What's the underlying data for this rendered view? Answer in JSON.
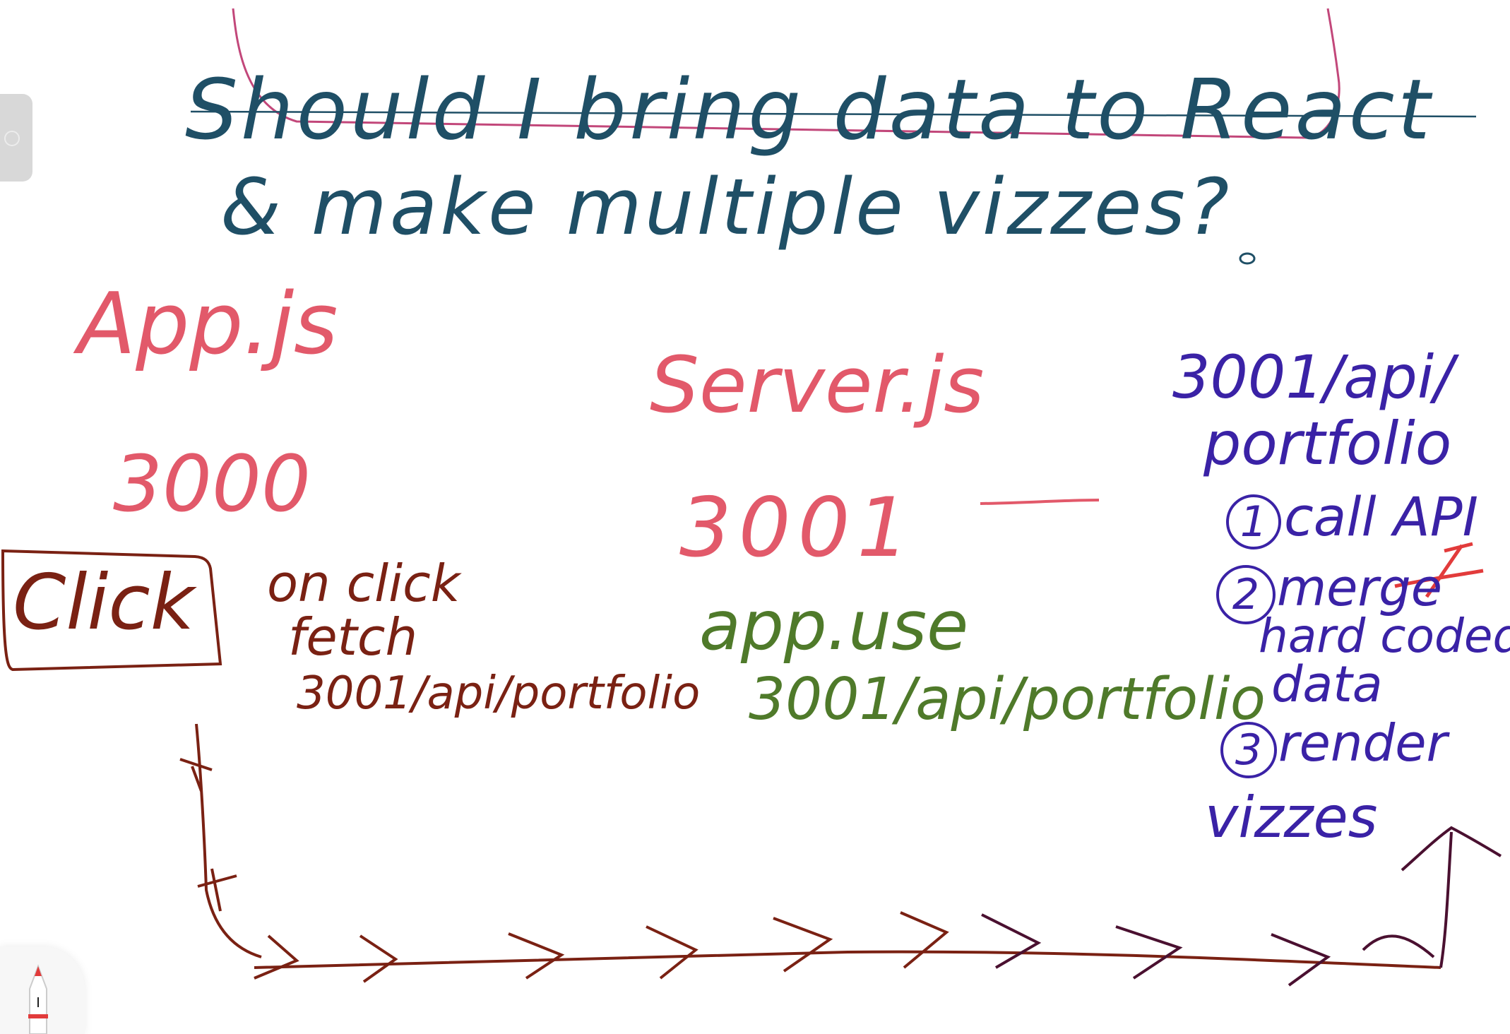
{
  "question": {
    "line1": "Should I bring data to React",
    "line2": "& make multiple vizzes?"
  },
  "nodes": {
    "app": {
      "title": "App.js",
      "port": "3000"
    },
    "server": {
      "title": "Server.js",
      "port": "3001",
      "route_line1": "app.use",
      "route_line2": "3001/api/portfolio"
    },
    "endpoint": {
      "route_line1": "3001/api/",
      "route_line2": "portfolio",
      "step1_num": "1",
      "step1": "call API",
      "step2_num": "2",
      "step2_line1": "merge",
      "step2_line2": "hard coded",
      "step2_line3": "data",
      "step3_num": "3",
      "step3": "render",
      "step3_line2": "vizzes"
    },
    "click_box": {
      "label": "Click"
    },
    "handler": {
      "line1": "on click",
      "line2": "fetch",
      "line3": "3001/api/portfolio"
    }
  },
  "colors": {
    "question": "#1f4f66",
    "highlight": "#c2477a",
    "app_server": "#e2596a",
    "click_flow": "#7a2113",
    "server_route": "#4f7a2a",
    "endpoint": "#3a22a6",
    "arrow_end": "#4a1030"
  },
  "tools": {
    "side_handle_icon": "chevron-right-icon",
    "pencil_icon": "pencil-icon"
  }
}
